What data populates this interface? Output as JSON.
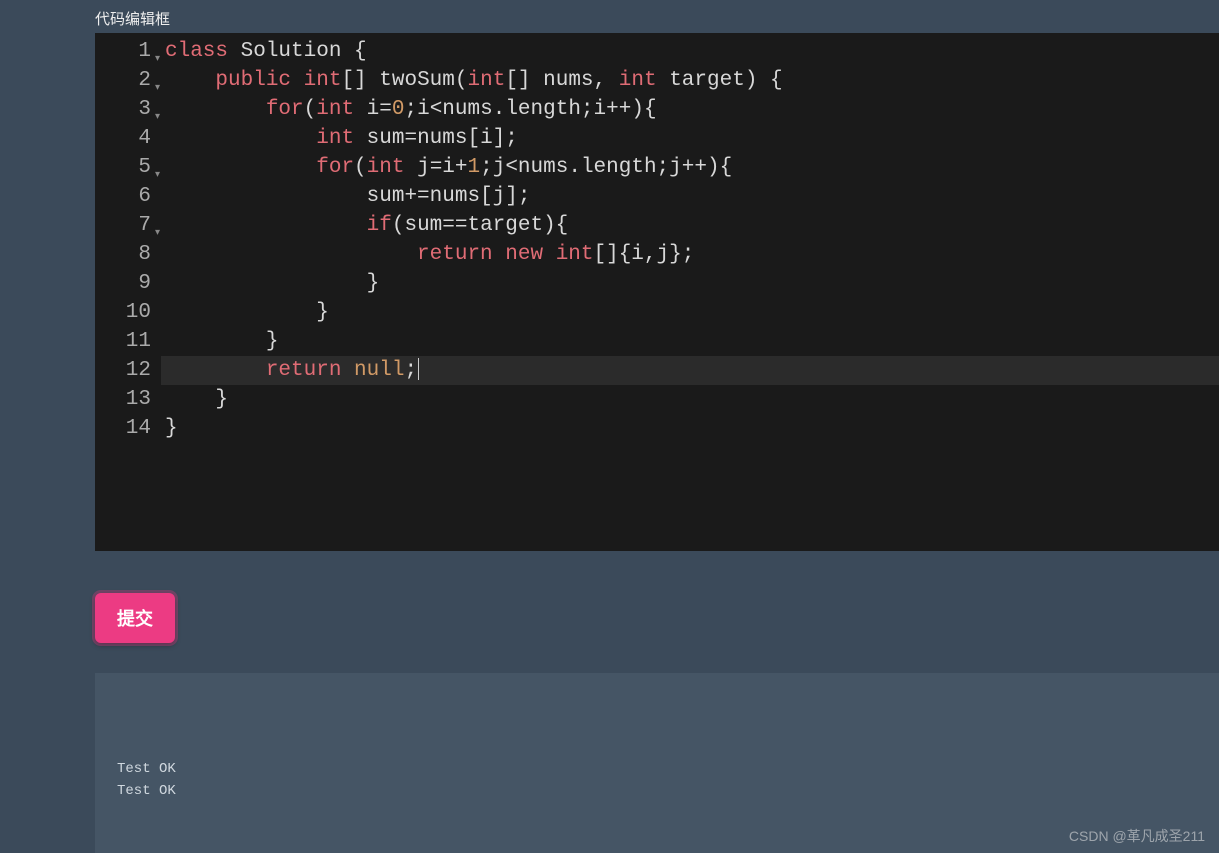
{
  "editor": {
    "label": "代码编辑框",
    "lineCount": 14,
    "activeLine": 12,
    "code": {
      "l1": {
        "tokens": [
          {
            "t": "class ",
            "c": "kw"
          },
          {
            "t": "Solution",
            "c": "cls"
          },
          {
            "t": " {",
            "c": "pun"
          }
        ],
        "fold": true
      },
      "l2": {
        "indent": "    ",
        "tokens": [
          {
            "t": "public ",
            "c": "kw"
          },
          {
            "t": "int",
            "c": "type"
          },
          {
            "t": "[] ",
            "c": "pun"
          },
          {
            "t": "twoSum",
            "c": "fn"
          },
          {
            "t": "(",
            "c": "pun"
          },
          {
            "t": "int",
            "c": "type"
          },
          {
            "t": "[] ",
            "c": "pun"
          },
          {
            "t": "nums",
            "c": "var"
          },
          {
            "t": ", ",
            "c": "pun"
          },
          {
            "t": "int ",
            "c": "type"
          },
          {
            "t": "target",
            "c": "var"
          },
          {
            "t": ") {",
            "c": "pun"
          }
        ],
        "fold": true
      },
      "l3": {
        "indent": "        ",
        "tokens": [
          {
            "t": "for",
            "c": "kw"
          },
          {
            "t": "(",
            "c": "pun"
          },
          {
            "t": "int ",
            "c": "type"
          },
          {
            "t": "i",
            "c": "var"
          },
          {
            "t": "=",
            "c": "op"
          },
          {
            "t": "0",
            "c": "num"
          },
          {
            "t": ";i<nums.length;i++){",
            "c": "var"
          }
        ],
        "fold": true
      },
      "l4": {
        "indent": "            ",
        "tokens": [
          {
            "t": "int ",
            "c": "type"
          },
          {
            "t": "sum=nums[i];",
            "c": "var"
          }
        ]
      },
      "l5": {
        "indent": "            ",
        "tokens": [
          {
            "t": "for",
            "c": "kw"
          },
          {
            "t": "(",
            "c": "pun"
          },
          {
            "t": "int ",
            "c": "type"
          },
          {
            "t": "j",
            "c": "var"
          },
          {
            "t": "=i",
            "c": "var"
          },
          {
            "t": "+",
            "c": "op"
          },
          {
            "t": "1",
            "c": "num"
          },
          {
            "t": ";j<nums.length;j++){",
            "c": "var"
          }
        ],
        "fold": true
      },
      "l6": {
        "indent": "                ",
        "tokens": [
          {
            "t": "sum+=nums[j];",
            "c": "var"
          }
        ]
      },
      "l7": {
        "indent": "                ",
        "tokens": [
          {
            "t": "if",
            "c": "kw"
          },
          {
            "t": "(sum==target){",
            "c": "var"
          }
        ],
        "fold": true
      },
      "l8": {
        "indent": "                    ",
        "tokens": [
          {
            "t": "return ",
            "c": "kw"
          },
          {
            "t": "new ",
            "c": "kw"
          },
          {
            "t": "int",
            "c": "type"
          },
          {
            "t": "[]{i,j};",
            "c": "var"
          }
        ]
      },
      "l9": {
        "indent": "                ",
        "tokens": [
          {
            "t": "}",
            "c": "pun"
          }
        ]
      },
      "l10": {
        "indent": "            ",
        "tokens": [
          {
            "t": "}",
            "c": "pun"
          }
        ]
      },
      "l11": {
        "indent": "        ",
        "tokens": [
          {
            "t": "}",
            "c": "pun"
          }
        ]
      },
      "l12": {
        "indent": "        ",
        "tokens": [
          {
            "t": "return ",
            "c": "kw"
          },
          {
            "t": "null",
            "c": "null"
          },
          {
            "t": ";",
            "c": "pun"
          }
        ],
        "cursor": true
      },
      "l13": {
        "indent": "    ",
        "tokens": [
          {
            "t": "}",
            "c": "pun"
          }
        ]
      },
      "l14": {
        "indent": "",
        "tokens": [
          {
            "t": "}",
            "c": "pun"
          }
        ]
      }
    }
  },
  "submit": {
    "label": "提交"
  },
  "output": {
    "lines": [
      "Test OK",
      "Test OK"
    ]
  },
  "watermark": "CSDN @革凡成圣211"
}
